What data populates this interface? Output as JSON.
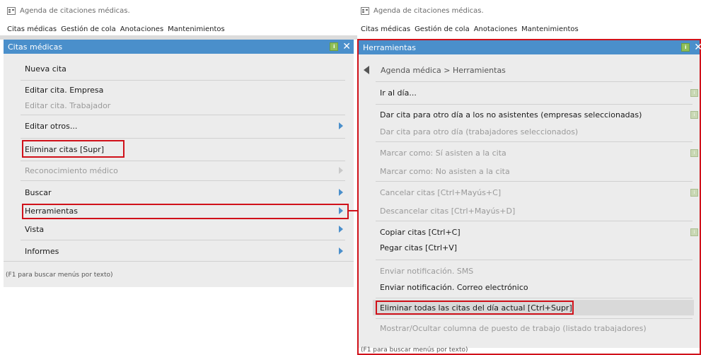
{
  "window": {
    "app_title": "Agenda de citaciones médicas.",
    "menu": [
      "Citas médicas",
      "Gestión de cola",
      "Anotaciones",
      "Mantenimientos"
    ]
  },
  "left_panel": {
    "title": "Citas médicas",
    "items": [
      {
        "label": "Nueva cita",
        "enabled": true,
        "submenu": false
      },
      {
        "label": "Editar cita. Empresa",
        "enabled": true,
        "submenu": false
      },
      {
        "label": "Editar cita. Trabajador",
        "enabled": false,
        "submenu": false
      },
      {
        "label": "Editar otros...",
        "enabled": true,
        "submenu": true
      },
      {
        "label": "Eliminar citas  [Supr]",
        "enabled": true,
        "submenu": false,
        "highlighted": true
      },
      {
        "label": "Reconocimiento médico",
        "enabled": false,
        "submenu": true
      },
      {
        "label": "Buscar",
        "enabled": true,
        "submenu": true
      },
      {
        "label": "Herramientas",
        "enabled": true,
        "submenu": true,
        "highlighted": true
      },
      {
        "label": "Vista",
        "enabled": true,
        "submenu": true
      },
      {
        "label": "Informes",
        "enabled": true,
        "submenu": true
      }
    ],
    "footer": "(F1 para buscar menús por texto)"
  },
  "right_panel": {
    "title": "Herramientas",
    "breadcrumb": "Agenda médica > Herramientas",
    "items": [
      {
        "label": "Ir al día...",
        "enabled": true
      },
      {
        "label": "Dar cita para otro día a los no asistentes (empresas seleccionadas)",
        "enabled": true
      },
      {
        "label": "Dar cita para otro día (trabajadores seleccionados)",
        "enabled": false
      },
      {
        "label": "Marcar como: Sí asisten a la cita",
        "enabled": false
      },
      {
        "label": "Marcar como: No asisten a la cita",
        "enabled": false
      },
      {
        "label": "Cancelar citas  [Ctrl+Mayús+C]",
        "enabled": false
      },
      {
        "label": "Descancelar citas  [Ctrl+Mayús+D]",
        "enabled": false
      },
      {
        "label": "Copiar citas  [Ctrl+C]",
        "enabled": true
      },
      {
        "label": "Pegar citas  [Ctrl+V]",
        "enabled": true
      },
      {
        "label": "Enviar notificación. SMS",
        "enabled": false
      },
      {
        "label": "Enviar notificación. Correo electrónico",
        "enabled": true
      },
      {
        "label": "Eliminar todas las citas del día actual  [Ctrl+Supr]",
        "enabled": true,
        "highlighted": true
      },
      {
        "label": "Mostrar/Ocultar columna de puesto de trabajo (listado trabajadores)",
        "enabled": false
      }
    ],
    "footer": "(F1 para buscar menús por texto)"
  },
  "colors": {
    "header": "#4a8fcb",
    "highlight_border": "#d0111a",
    "disabled_text": "#9a9a9a"
  }
}
